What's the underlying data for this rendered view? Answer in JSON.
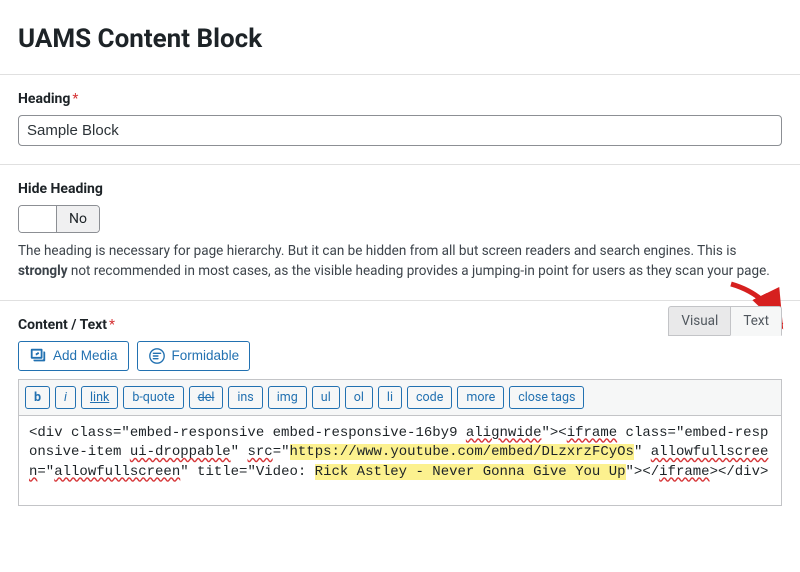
{
  "title": "UAMS Content Block",
  "heading": {
    "label": "Heading",
    "required": true,
    "value": "Sample Block"
  },
  "hide": {
    "label": "Hide Heading",
    "state": "No",
    "help_pre": "The heading is necessary for page hierarchy. But it can be hidden from all but screen readers and search engines. This is ",
    "help_strong": "strongly",
    "help_post": " not recommended in most cases, as the visible heading provides a jumping-in point for users as they scan your page."
  },
  "content": {
    "label": "Content / Text",
    "required": true,
    "buttons": {
      "add_media": "Add Media",
      "formidable": "Formidable"
    },
    "tabs": {
      "visual": "Visual",
      "text": "Text",
      "active": "Text"
    },
    "ql": {
      "b": "b",
      "i": "i",
      "link": "link",
      "bquote": "b-quote",
      "del": "del",
      "ins": "ins",
      "img": "img",
      "ul": "ul",
      "ol": "ol",
      "li": "li",
      "code": "code",
      "more": "more",
      "close": "close tags"
    },
    "body": {
      "seg1": "<div class=\"embed-responsive embed-responsive-16by9 ",
      "seg2_spell": "alignwide",
      "seg3": "\"><",
      "seg4_spell": "iframe",
      "seg5": " class=\"embed-responsive-item ",
      "seg6_spell": "ui-droppable",
      "seg7": "\" ",
      "seg8_spell": "src",
      "seg9": "=\"",
      "seg10_hl": "https://www.youtube.com/embed/DLzxrzFCyOs",
      "seg11": "\" ",
      "seg12_spell": "allowfullscreen",
      "seg13": "=\"",
      "seg14_spell": "allowfullscreen",
      "seg15": "\" title=\"Video: ",
      "seg16_hl": "Rick Astley - Never Gonna Give You Up",
      "seg17": "\"></",
      "seg18_spell": "iframe",
      "seg19": "></div>"
    }
  }
}
